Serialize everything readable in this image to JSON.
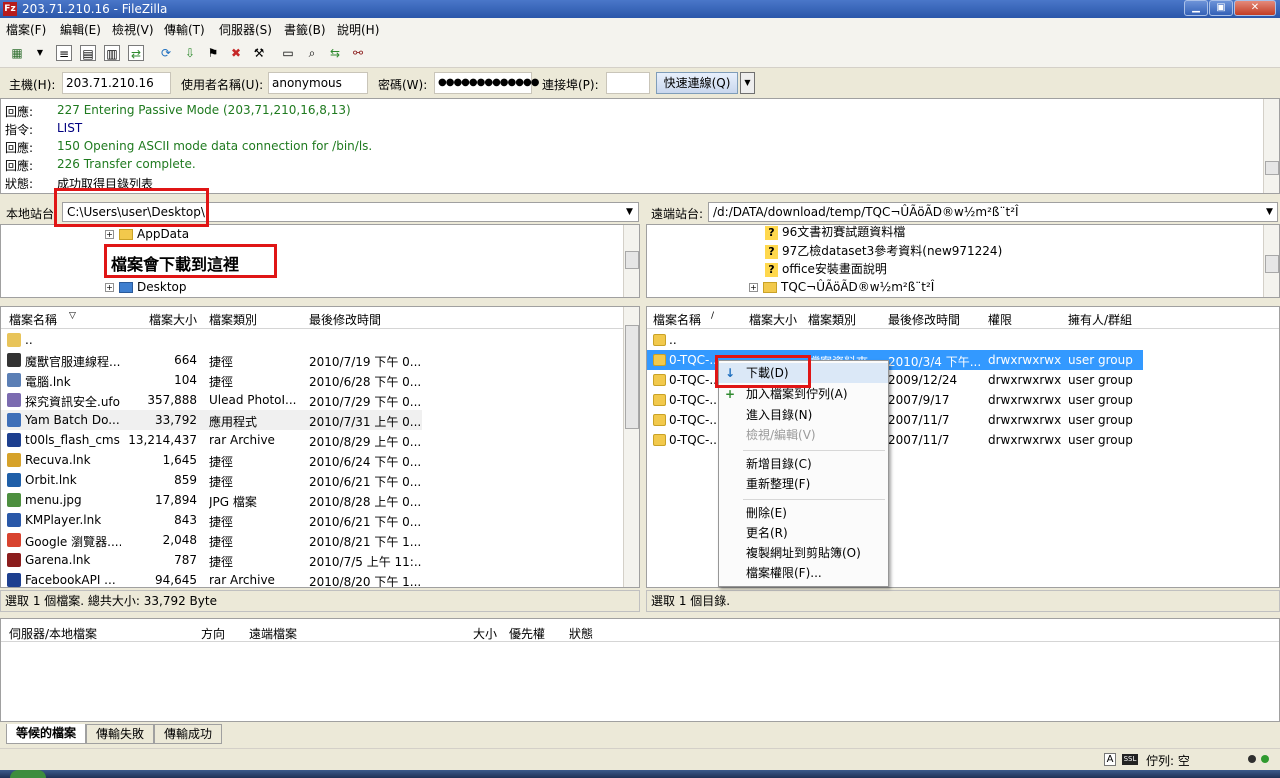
{
  "window": {
    "title": "203.71.210.16 - FileZilla",
    "app_icon": "Fz"
  },
  "menu": [
    "檔案(F)",
    "編輯(E)",
    "檢視(V)",
    "傳輸(T)",
    "伺服器(S)",
    "書籤(B)",
    "說明(H)"
  ],
  "quickconnect": {
    "host_label": "主機(H):",
    "host": "203.71.210.16",
    "user_label": "使用者名稱(U):",
    "user": "anonymous",
    "pass_label": "密碼(W):",
    "pass": "●●●●●●●●●●●●●",
    "port_label": "連接埠(P):",
    "port": "",
    "button": "快速連線(Q)"
  },
  "log": [
    {
      "type": "回應:",
      "msg": "227 Entering Passive Mode (203,71,210,16,8,13)",
      "color": "green"
    },
    {
      "type": "指令:",
      "msg": "LIST",
      "color": "navy"
    },
    {
      "type": "回應:",
      "msg": "150 Opening ASCII mode data connection for /bin/ls.",
      "color": "green"
    },
    {
      "type": "回應:",
      "msg": "226 Transfer complete.",
      "color": "green"
    },
    {
      "type": "狀態:",
      "msg": "成功取得目錄列表",
      "color": "black"
    }
  ],
  "local": {
    "label": "本地站台:",
    "path": "C:\\Users\\user\\Desktop\\",
    "tree": [
      "AppData",
      "Desktop"
    ],
    "annotation": "檔案會下載到這裡",
    "headers": [
      "檔案名稱",
      "檔案大小",
      "檔案類別",
      "最後修改時間"
    ],
    "files": [
      {
        "name": "..",
        "size": "",
        "type": "",
        "modified": "",
        "icon": "#e8c45a"
      },
      {
        "name": "魔獸官服連線程...",
        "size": "664",
        "type": "捷徑",
        "modified": "2010/7/19 下午 0...",
        "icon": "#333333"
      },
      {
        "name": "電腦.lnk",
        "size": "104",
        "type": "捷徑",
        "modified": "2010/6/28 下午 0...",
        "icon": "#5b7fb5"
      },
      {
        "name": "探究資訊安全.ufo",
        "size": "357,888",
        "type": "Ulead PhotoI...",
        "modified": "2010/7/29 下午 0...",
        "icon": "#7b6bb0"
      },
      {
        "name": "Yam Batch Do...",
        "size": "33,792",
        "type": "應用程式",
        "modified": "2010/7/31 上午 0...",
        "icon": "#3f6fb8"
      },
      {
        "name": "t00ls_flash_cms....",
        "size": "13,214,437",
        "type": "rar Archive",
        "modified": "2010/8/29 上午 0...",
        "icon": "#1d3f8f"
      },
      {
        "name": "Recuva.lnk",
        "size": "1,645",
        "type": "捷徑",
        "modified": "2010/6/24 下午 0...",
        "icon": "#d6a22a"
      },
      {
        "name": "Orbit.lnk",
        "size": "859",
        "type": "捷徑",
        "modified": "2010/6/21 下午 0...",
        "icon": "#1f5fa8"
      },
      {
        "name": "menu.jpg",
        "size": "17,894",
        "type": "JPG 檔案",
        "modified": "2010/8/28 上午 0...",
        "icon": "#4d8f3f"
      },
      {
        "name": "KMPlayer.lnk",
        "size": "843",
        "type": "捷徑",
        "modified": "2010/6/21 下午 0...",
        "icon": "#2a58a8"
      },
      {
        "name": "Google 瀏覽器....",
        "size": "2,048",
        "type": "捷徑",
        "modified": "2010/8/21 下午 1...",
        "icon": "#d8432f"
      },
      {
        "name": "Garena.lnk",
        "size": "787",
        "type": "捷徑",
        "modified": "2010/7/5 上午 11:...",
        "icon": "#8b1d1d"
      },
      {
        "name": "FacebookAPI ...",
        "size": "94,645",
        "type": "rar Archive",
        "modified": "2010/8/20 下午 1...",
        "icon": "#1d3f8f"
      }
    ],
    "status": "選取 1 個檔案. 總共大小: 33,792 Byte"
  },
  "remote": {
    "label": "遠端站台:",
    "path": "/d:/DATA/download/temp/TQC¬ÛÃöÃD®w½m²ß¨t²Î",
    "tree": [
      "96文書初賽試題資料檔",
      "97乙檢dataset3參考資料(new971224)",
      "office安裝畫面說明",
      "TQC¬ÛÃöÃD®w½m²ß¨t²Î"
    ],
    "headers": [
      "檔案名稱",
      "檔案大小",
      "檔案類別",
      "最後修改時間",
      "權限",
      "擁有人/群組"
    ],
    "files": [
      {
        "name": "..",
        "type": "",
        "modified": "",
        "perm": "",
        "owner": ""
      },
      {
        "name": "0-TQC-...",
        "type": "檔案資料夾",
        "modified": "2010/3/4 下午...",
        "perm": "drwxrwxrwx",
        "owner": "user group"
      },
      {
        "name": "0-TQC-...",
        "type": "",
        "modified": "2009/12/24",
        "perm": "drwxrwxrwx",
        "owner": "user group"
      },
      {
        "name": "0-TQC-...",
        "type": "",
        "modified": "2007/9/17",
        "perm": "drwxrwxrwx",
        "owner": "user group"
      },
      {
        "name": "0-TQC-...",
        "type": "",
        "modified": "2007/11/7",
        "perm": "drwxrwxrwx",
        "owner": "user group"
      },
      {
        "name": "0-TQC-...",
        "type": "",
        "modified": "2007/11/7",
        "perm": "drwxrwxrwx",
        "owner": "user group"
      }
    ],
    "status": "選取 1 個目錄."
  },
  "context_menu": [
    "下載(D)",
    "加入檔案到佇列(A)",
    "進入目錄(N)",
    "檢視/編輯(V)",
    "新增目錄(C)",
    "重新整理(F)",
    "刪除(E)",
    "更名(R)",
    "複製網址到剪貼簿(O)",
    "檔案權限(F)..."
  ],
  "queue": {
    "headers": [
      "伺服器/本地檔案",
      "方向",
      "遠端檔案",
      "大小",
      "優先權",
      "狀態"
    ],
    "tabs": [
      "等候的檔案",
      "傳輸失敗",
      "傳輸成功"
    ]
  },
  "statusbar": {
    "queue": "佇列: 空"
  }
}
